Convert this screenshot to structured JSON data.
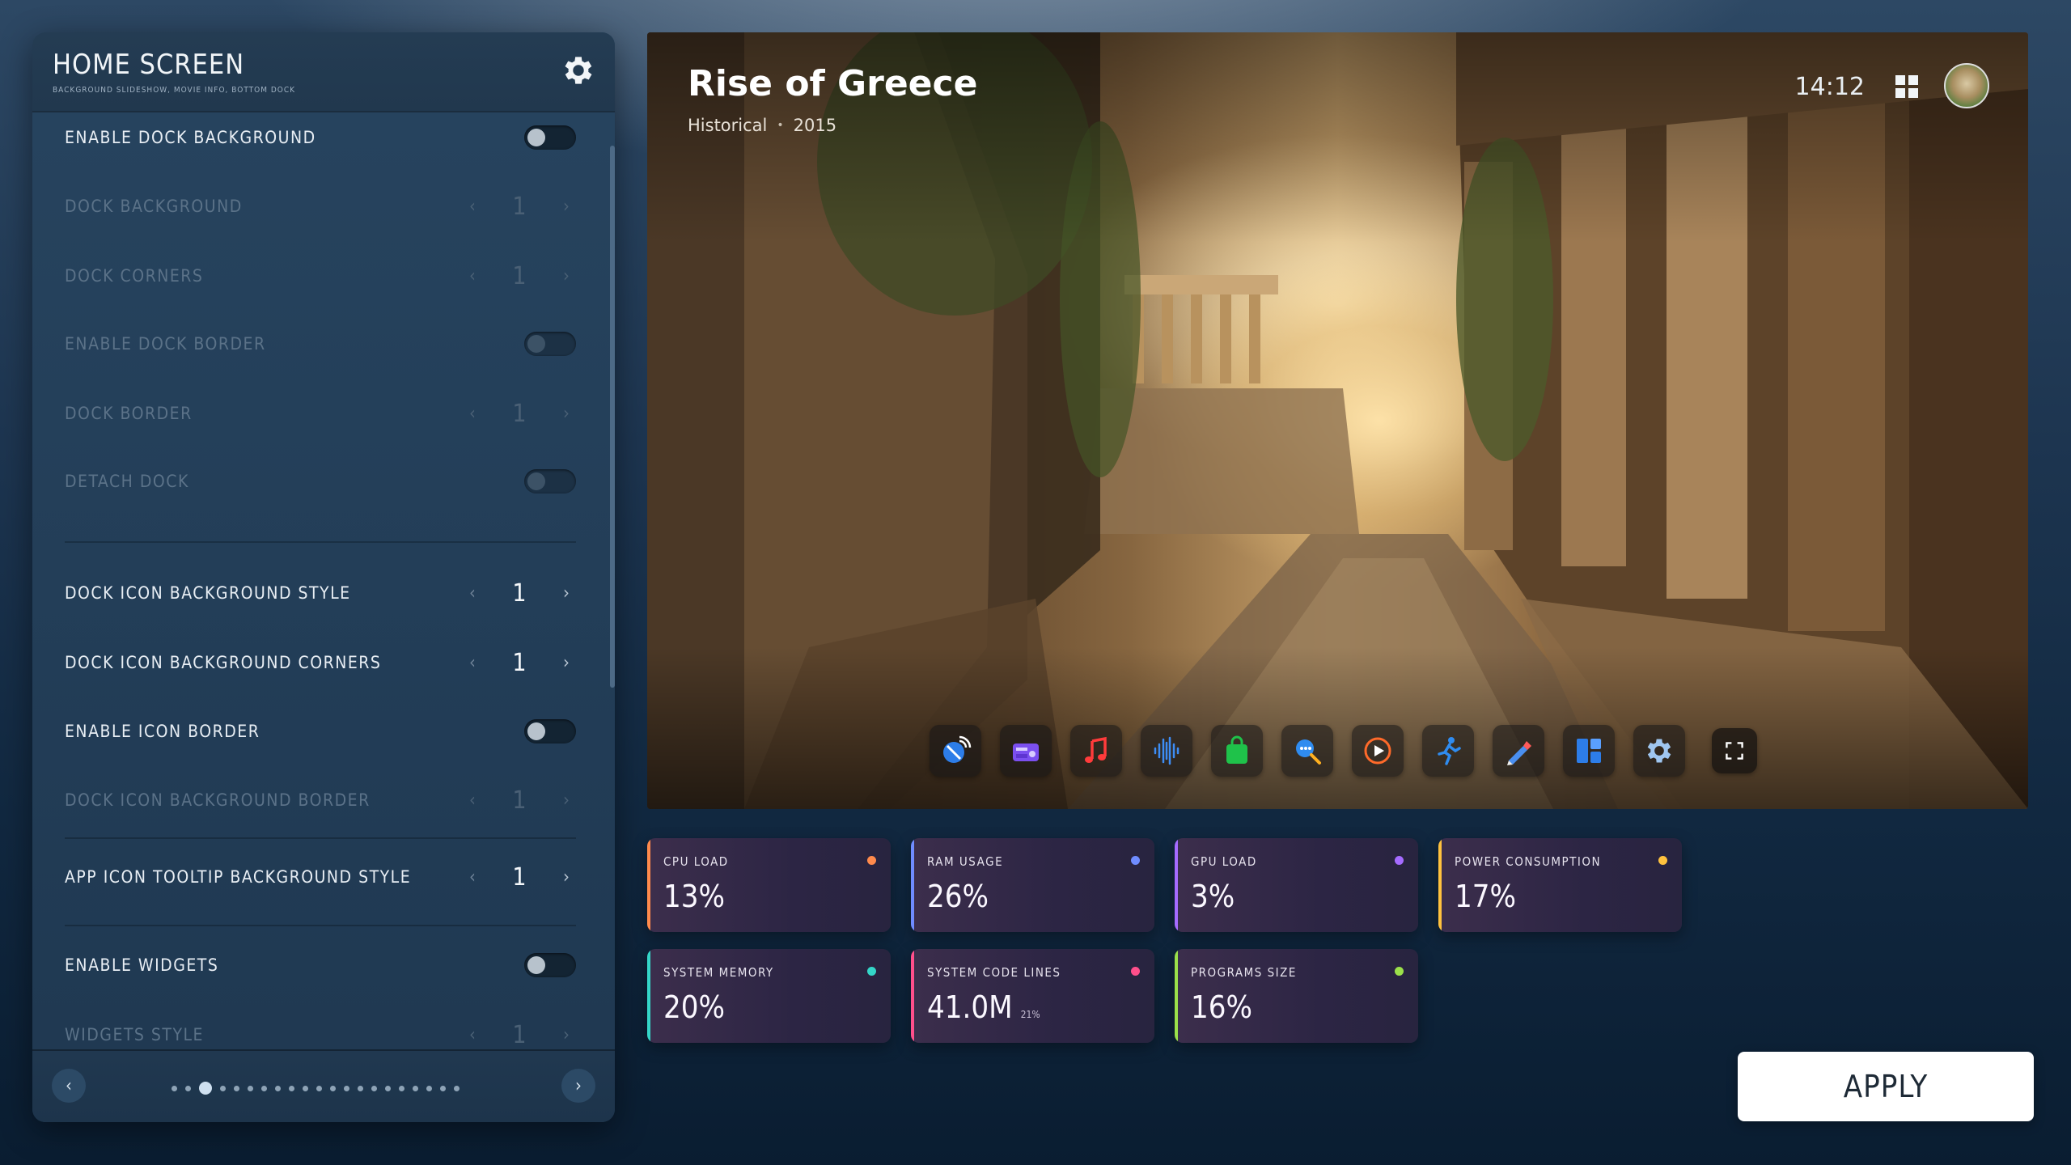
{
  "settings": {
    "title": "HOME SCREEN",
    "subtitle": "BACKGROUND SLIDESHOW, MOVIE INFO, BOTTOM DOCK",
    "rows": [
      {
        "label": "ENABLE DOCK BACKGROUND",
        "type": "toggle",
        "state": "off",
        "enabled": true
      },
      {
        "label": "DOCK BACKGROUND",
        "type": "stepper",
        "value": "1",
        "enabled": false
      },
      {
        "label": "DOCK CORNERS",
        "type": "stepper",
        "value": "1",
        "enabled": false
      },
      {
        "label": "ENABLE DOCK BORDER",
        "type": "toggle",
        "state": "off",
        "enabled": false
      },
      {
        "label": "DOCK BORDER",
        "type": "stepper",
        "value": "1",
        "enabled": false
      },
      {
        "label": "DETACH DOCK",
        "type": "toggle",
        "state": "off",
        "enabled": false
      },
      {
        "label": "DOCK ICON BACKGROUND STYLE",
        "type": "stepper",
        "value": "1",
        "enabled": true
      },
      {
        "label": "DOCK ICON BACKGROUND CORNERS",
        "type": "stepper",
        "value": "1",
        "enabled": true
      },
      {
        "label": "ENABLE ICON BORDER",
        "type": "toggle",
        "state": "off",
        "enabled": true
      },
      {
        "label": "DOCK ICON BACKGROUND BORDER",
        "type": "stepper",
        "value": "1",
        "enabled": false
      },
      {
        "label": "APP ICON TOOLTIP BACKGROUND STYLE",
        "type": "stepper",
        "value": "1",
        "enabled": true
      },
      {
        "label": "ENABLE WIDGETS",
        "type": "toggle",
        "state": "off",
        "enabled": true
      },
      {
        "label": "WIDGETS STYLE",
        "type": "stepper",
        "value": "1",
        "enabled": false
      }
    ],
    "pager": {
      "count": 21,
      "active_index": 2,
      "prev_icon": "chevron-left-icon",
      "next_icon": "chevron-right-icon"
    }
  },
  "hero": {
    "title": "Rise of Greece",
    "genre": "Historical",
    "separator": "•",
    "year": "2015",
    "clock": "14:12",
    "dock_icons": [
      "satellite-dish-icon",
      "radio-icon",
      "music-note-icon",
      "audio-wave-icon",
      "shopping-bag-icon",
      "search-icon",
      "play-icon",
      "running-figure-icon",
      "pen-icon",
      "dashboard-icon",
      "gear-icon",
      "fullscreen-icon"
    ]
  },
  "stats": [
    {
      "label": "CPU LOAD",
      "value": "13%",
      "color": "#ff8a4c"
    },
    {
      "label": "RAM USAGE",
      "value": "26%",
      "color": "#6f8cff"
    },
    {
      "label": "GPU LOAD",
      "value": "3%",
      "color": "#a56bff"
    },
    {
      "label": "POWER CONSUMPTION",
      "value": "17%",
      "color": "#ffc23e"
    },
    {
      "label": "SYSTEM MEMORY",
      "value": "20%",
      "color": "#34d6c8"
    },
    {
      "label": "SYSTEM CODE LINES",
      "value": "41.0M",
      "sub": "21%",
      "color": "#ff4f8b"
    },
    {
      "label": "PROGRAMS SIZE",
      "value": "16%",
      "color": "#9be04a"
    }
  ],
  "apply_label": "APPLY"
}
